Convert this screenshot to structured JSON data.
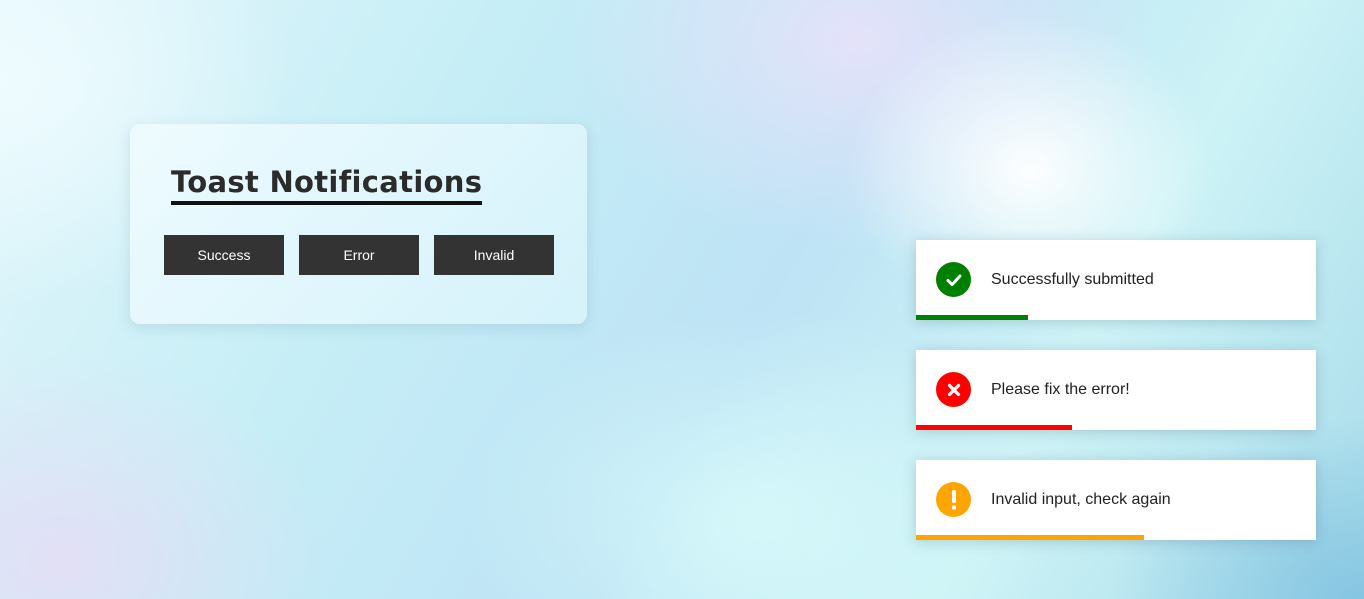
{
  "panel": {
    "title": "Toast Notifications",
    "buttons": [
      {
        "label": "Success"
      },
      {
        "label": "Error"
      },
      {
        "label": "Invalid"
      }
    ]
  },
  "toasts": [
    {
      "message": "Successfully submitted",
      "icon": "check-circle-icon",
      "color": "#008000",
      "progress": 0.28
    },
    {
      "message": "Please fix the error!",
      "icon": "x-circle-icon",
      "color": "#ff0000",
      "progress": 0.39
    },
    {
      "message": "Invalid input, check again",
      "icon": "exclamation-circle-icon",
      "color": "#ffa500",
      "progress": 0.57
    }
  ]
}
